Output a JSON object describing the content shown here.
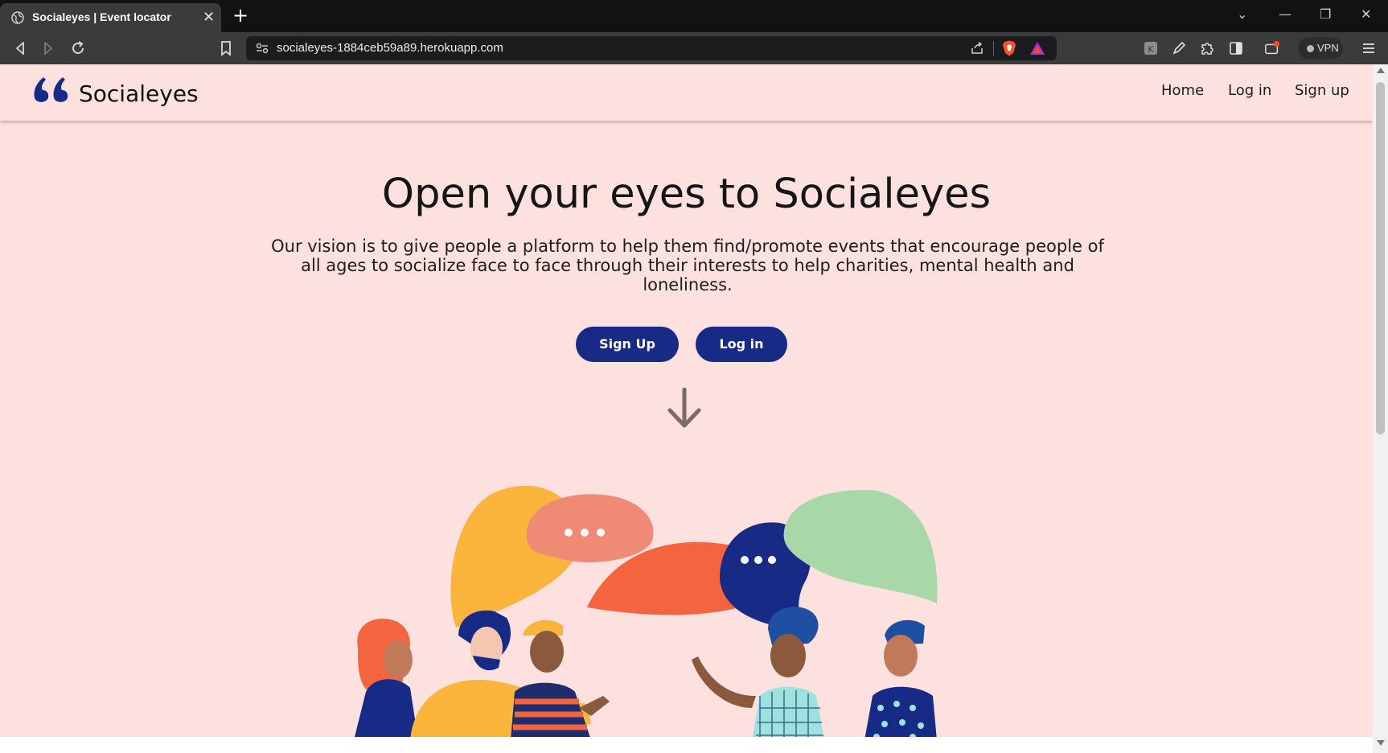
{
  "browser": {
    "tab_title": "Socialeyes | Event locator",
    "url": "socialeyes-1884ceb59a89.herokuapp.com",
    "vpn_label": "VPN",
    "icons": [
      "globe-icon",
      "close-icon",
      "plus-icon",
      "chevron-down-icon",
      "minimize-icon",
      "restore-icon",
      "window-close-icon",
      "back-icon",
      "forward-icon",
      "reload-icon",
      "bookmark-icon",
      "site-settings-icon",
      "share-icon",
      "brave-shield-icon",
      "brave-rewards-icon",
      "extension-icon",
      "pen-icon",
      "puzzle-icon",
      "sidebar-icon",
      "wallet-icon",
      "menu-icon"
    ]
  },
  "navbar": {
    "brand": "Socialeyes",
    "links": [
      "Home",
      "Log in",
      "Sign up"
    ]
  },
  "hero": {
    "title": "Open your eyes to Socialeyes",
    "text": "Our vision is to give people a platform to help them find/promote events that encourage people of all ages to socialize face to face through their interests to help charities, mental health and loneliness.",
    "signup_label": "Sign Up",
    "login_label": "Log in"
  },
  "colors": {
    "page_bg": "#fde1df",
    "brand_navy": "#172a85",
    "speech_yellow": "#fbb53c",
    "speech_salmon": "#ef8a74",
    "speech_orange": "#f4643f",
    "speech_green": "#a8d8a8"
  }
}
